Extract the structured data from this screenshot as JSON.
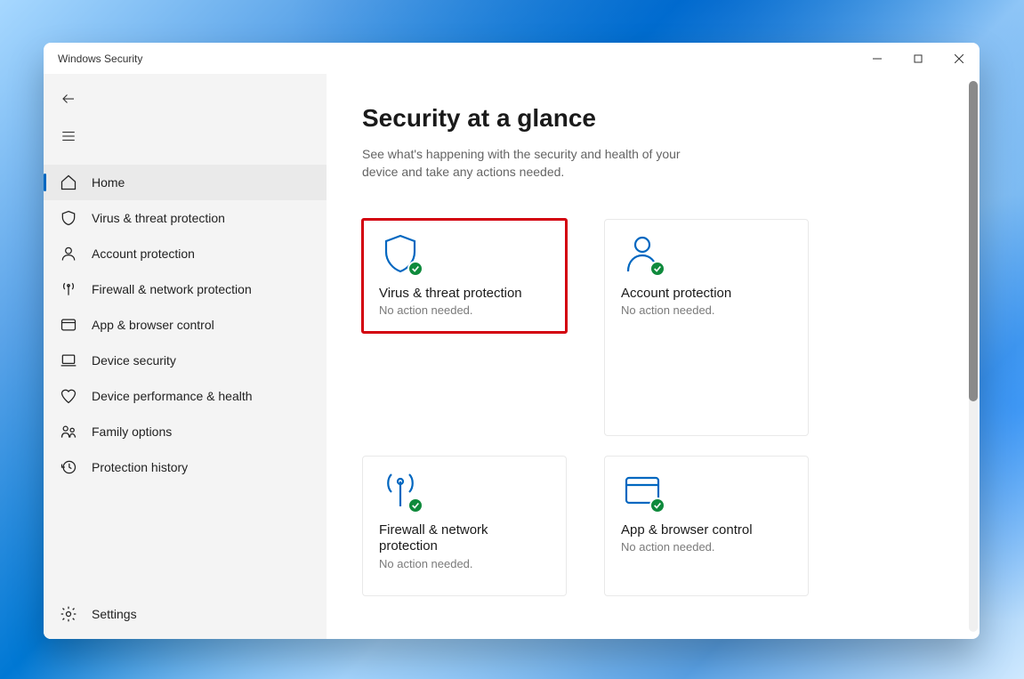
{
  "window": {
    "title": "Windows Security"
  },
  "sidebar": {
    "items": [
      {
        "label": "Home"
      },
      {
        "label": "Virus & threat protection"
      },
      {
        "label": "Account protection"
      },
      {
        "label": "Firewall & network protection"
      },
      {
        "label": "App & browser control"
      },
      {
        "label": "Device security"
      },
      {
        "label": "Device performance & health"
      },
      {
        "label": "Family options"
      },
      {
        "label": "Protection history"
      }
    ],
    "settings_label": "Settings"
  },
  "main": {
    "heading": "Security at a glance",
    "subtitle": "See what's happening with the security and health of your device and take any actions needed.",
    "tiles": [
      {
        "title": "Virus & threat protection",
        "status": "No action needed."
      },
      {
        "title": "Account protection",
        "status": "No action needed."
      },
      {
        "title": "Firewall & network protection",
        "status": "No action needed."
      },
      {
        "title": "App & browser control",
        "status": "No action needed."
      }
    ]
  }
}
